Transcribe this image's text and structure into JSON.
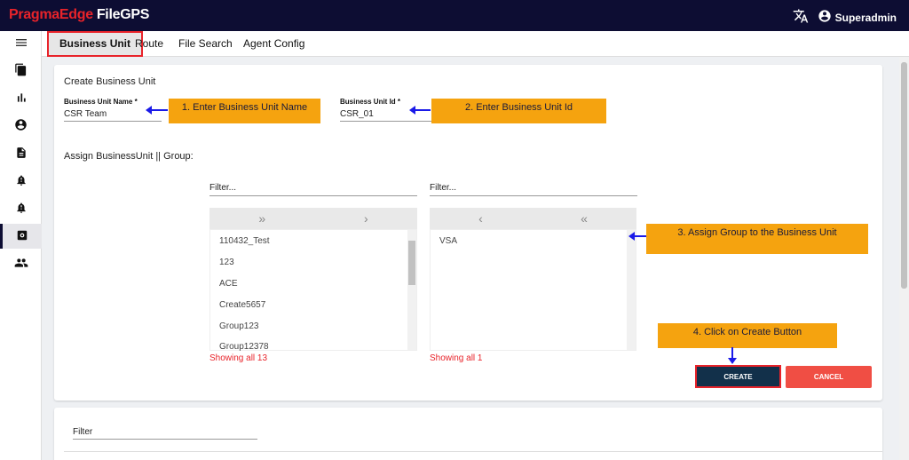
{
  "header": {
    "brand_part1": "PragmaEdge",
    "brand_part2": "FileGPS",
    "user_name": "Superadmin",
    "colors": {
      "topbar": "#0d0d33",
      "brand_red": "#e8232a"
    }
  },
  "sidebar": {
    "items": [
      {
        "icon": "menu-icon"
      },
      {
        "icon": "documents-icon"
      },
      {
        "icon": "bar-chart-icon"
      },
      {
        "icon": "account-circle-icon"
      },
      {
        "icon": "file-icon"
      },
      {
        "icon": "alert-bell-icon"
      },
      {
        "icon": "alert-bell-icon"
      },
      {
        "icon": "business-unit-icon",
        "active": true
      },
      {
        "icon": "users-icon"
      }
    ]
  },
  "tabs": [
    {
      "label": "Business Unit",
      "active": true
    },
    {
      "label": "Route"
    },
    {
      "label": "File Search"
    },
    {
      "label": "Agent Config"
    }
  ],
  "form": {
    "title": "Create Business Unit",
    "bu_name_label": "Business Unit Name *",
    "bu_name_value": "CSR Team",
    "bu_id_label": "Business Unit Id *",
    "bu_id_value": "CSR_01",
    "assign_label": "Assign BusinessUnit || Group:"
  },
  "left_list": {
    "filter_label": "Filter...",
    "items": [
      "110432_Test",
      "123",
      "ACE",
      "Create5657",
      "Group123",
      "Group12378"
    ],
    "showing": "Showing all 13",
    "head_buttons": [
      "»",
      "›"
    ]
  },
  "right_list": {
    "filter_label": "Filter...",
    "items": [
      "VSA"
    ],
    "showing": "Showing all 1",
    "head_buttons": [
      "‹",
      "«"
    ]
  },
  "callouts": {
    "c1": "1. Enter Business Unit Name",
    "c2": "2. Enter Business Unit Id",
    "c3": "3. Assign Group to the Business Unit",
    "c4": "4. Click on Create Button"
  },
  "buttons": {
    "create": "CREATE",
    "cancel": "CANCEL"
  },
  "card2": {
    "filter_label": "Filter"
  }
}
